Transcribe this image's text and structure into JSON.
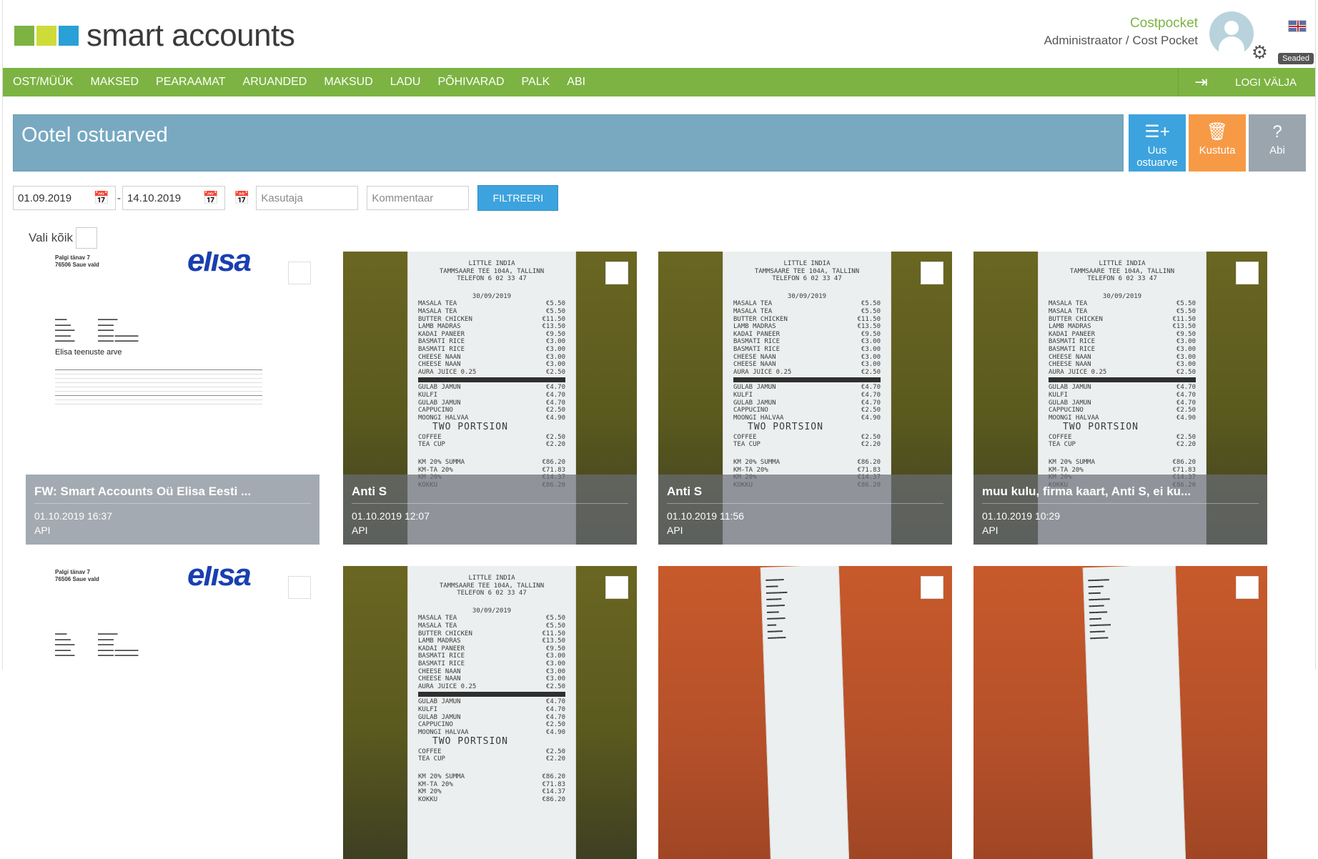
{
  "brand": {
    "name": "smart accounts",
    "colors": [
      "#7cb342",
      "#cddc39",
      "#29a0d6"
    ]
  },
  "account": {
    "company": "Costpocket",
    "role": "Administraator / Cost Pocket",
    "settings_label": "Seaded",
    "language_icon": "uk-flag-icon"
  },
  "nav": {
    "items": [
      "OST/MÜÜK",
      "MAKSED",
      "PEARAAMAT",
      "ARUANDED",
      "MAKSUD",
      "LADU",
      "PÕHIVARAD",
      "PALK",
      "ABI"
    ],
    "logout_label": "LOGI VÄLJA"
  },
  "page": {
    "title": "Ootel ostuarved"
  },
  "actions": {
    "new_label": "Uus ostuarve",
    "delete_label": "Kustuta",
    "help_label": "Abi"
  },
  "filter": {
    "date_from": "01.09.2019",
    "date_separator": "-",
    "date_to": "14.10.2019",
    "user_placeholder": "Kasutaja",
    "comment_placeholder": "Kommentaar",
    "filter_button": "FILTREERI"
  },
  "select_all_label": "Vali kõik",
  "cards": [
    {
      "title": "FW: Smart Accounts Oü Elisa Eesti ...",
      "datetime": "01.10.2019 16:37",
      "source": "API",
      "kind": "document"
    },
    {
      "title": "Anti S",
      "datetime": "01.10.2019 12:07",
      "source": "API",
      "kind": "receipt"
    },
    {
      "title": "Anti S",
      "datetime": "01.10.2019 11:56",
      "source": "API",
      "kind": "receipt"
    },
    {
      "title": "muu kulu, firma kaart, Anti S, ei ku...",
      "datetime": "01.10.2019 10:29",
      "source": "API",
      "kind": "receipt"
    }
  ],
  "doc_preview": {
    "address": [
      "Palgi tänav 7",
      "76506 Saue vald"
    ],
    "logo": "elisa",
    "title": "Elisa teenuste arve"
  },
  "receipt_preview": {
    "header": [
      "LITTLE INDIA",
      "TAMMSAARE TEE 104A, TALLINN",
      "TELEFON 6 02 33 47"
    ],
    "date": "30/09/2019",
    "items": [
      [
        "MASALA TEA",
        "€5.50"
      ],
      [
        "MASALA TEA",
        "€5.50"
      ],
      [
        "BUTTER CHICKEN",
        "€11.50"
      ],
      [
        "LAMB MADRAS",
        "€13.50"
      ],
      [
        "KADAI PANEER",
        "€9.50"
      ],
      [
        "BASMATI RICE",
        "€3.00"
      ],
      [
        "BASMATI RICE",
        "€3.00"
      ],
      [
        "CHEESE NAAN",
        "€3.00"
      ],
      [
        "CHEESE NAAN",
        "€3.00"
      ],
      [
        "AURA JUICE 0.25",
        "€2.50"
      ]
    ],
    "items2": [
      [
        "GULAB JAMUN",
        "€4.70"
      ],
      [
        "KULFI",
        "€4.70"
      ],
      [
        "GULAB JAMUN",
        "€4.70"
      ],
      [
        "CAPPUCINO",
        "€2.50"
      ],
      [
        "MOONGI HALVAA",
        "€4.90"
      ]
    ],
    "big": "TWO PORTSION",
    "items3": [
      [
        "COFFEE",
        "€2.50"
      ],
      [
        "TEA CUP",
        "€2.20"
      ]
    ],
    "totals": [
      [
        "KM 20% SUMMA",
        "€86.20"
      ],
      [
        "KM-TA 20%",
        "€71.83"
      ],
      [
        "KM 20%",
        "€14.37"
      ],
      [
        "KOKKU",
        "€86.20"
      ]
    ]
  }
}
